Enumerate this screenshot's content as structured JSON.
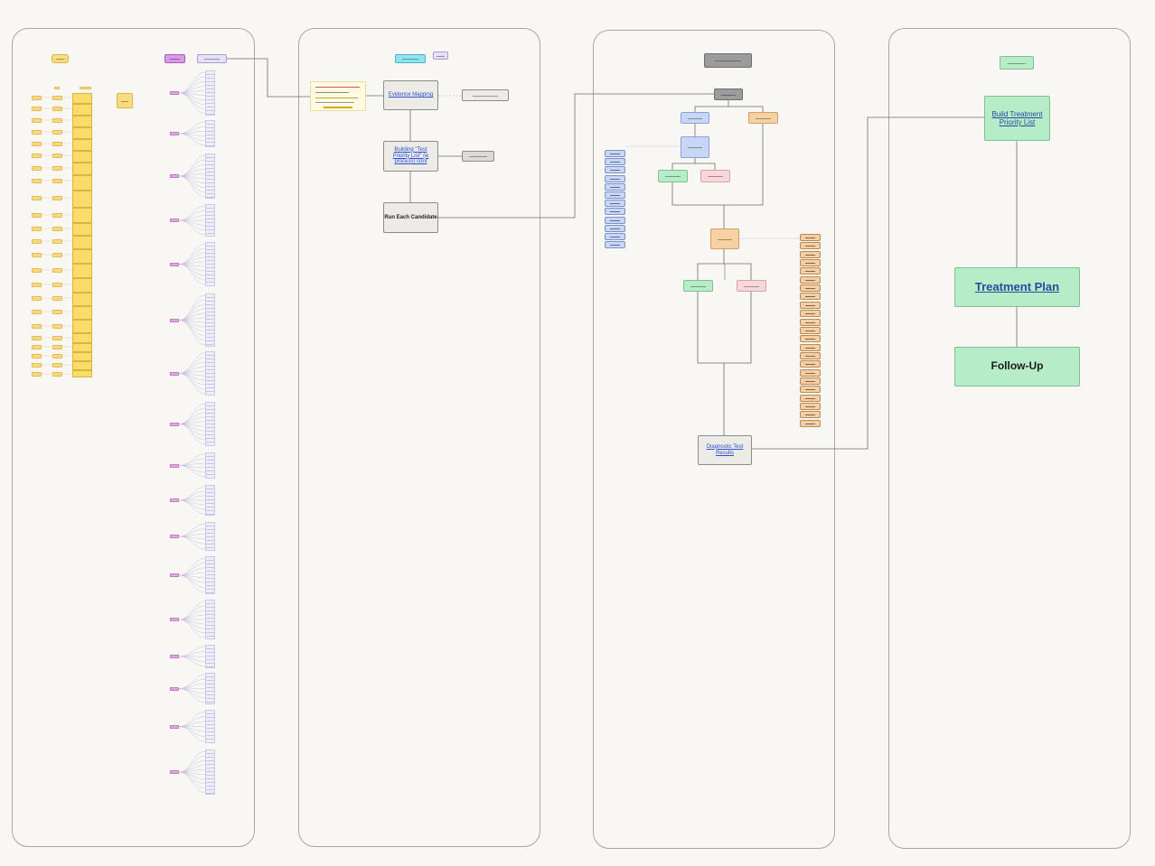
{
  "nodes": {
    "evidence_mapping": "Evidence Mapping",
    "building_test_priority": "Building \"Test Priority List\" (w process) cont",
    "run_each_candidate": "Run Each Candidate",
    "diagnostic_test_results": "Diagnostic Test Results",
    "build_treatment_priority": "Build Treatment Priority List",
    "treatment_plan": "Treatment Plan",
    "follow_up": "Follow-Up"
  },
  "colors": {
    "background": "#f8f7f4",
    "lane_border": "#a9a7a2",
    "connector": "#6e6c68",
    "link_text": "#2b50d6",
    "process_fill": "#ecebe6",
    "treatment_fill": "#b7ecc8",
    "branch_pink": "#f7d7d9",
    "branch_peach": "#f6d1a4",
    "branch_blue": "#c8d6f6",
    "yellow_list": "#f9dc6b",
    "purple_badge": "#e4a6e6"
  },
  "icons": [
    "sticky-note",
    "collapsed-node-lines"
  ]
}
